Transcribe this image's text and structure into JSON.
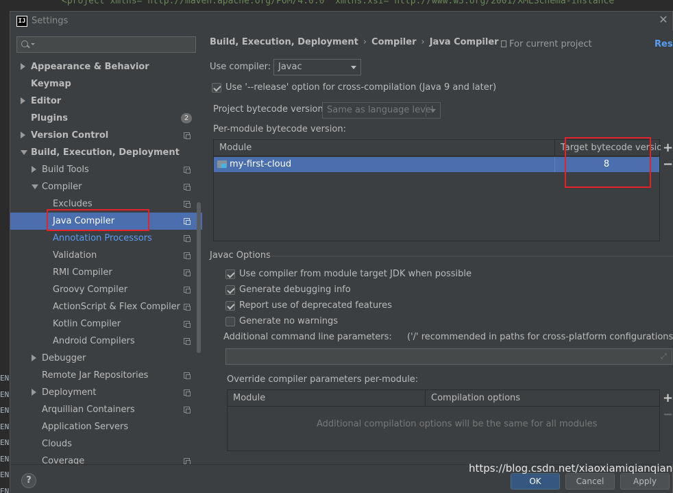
{
  "window": {
    "title": "Settings",
    "close_icon": "close-icon",
    "app_icon_text": "IJ"
  },
  "background_editor": {
    "line_text": "<project xmlns=\"http://maven.apache.org/POM/4.0.0\" xmlns:xsi=\"http://www.w3.org/2001/XMLSchema-instance\"",
    "gutter_lines": [
      "ENI",
      "ENI",
      "ENI",
      "ENI",
      "ENI",
      "ENI",
      "ENI",
      "ENI"
    ]
  },
  "sidebar": {
    "search_placeholder": "",
    "items": [
      {
        "label": "Appearance & Behavior",
        "bold": true,
        "arrow": "right",
        "copy": false
      },
      {
        "label": "Keymap",
        "bold": true,
        "arrow": "none",
        "copy": false
      },
      {
        "label": "Editor",
        "bold": true,
        "arrow": "right",
        "copy": false
      },
      {
        "label": "Plugins",
        "bold": true,
        "arrow": "none",
        "copy": false,
        "badge": "2"
      },
      {
        "label": "Version Control",
        "bold": true,
        "arrow": "right",
        "copy": true
      },
      {
        "label": "Build, Execution, Deployment",
        "bold": true,
        "arrow": "down",
        "copy": false
      },
      {
        "label": "Build Tools",
        "bold": false,
        "arrow": "right",
        "copy": true
      },
      {
        "label": "Compiler",
        "bold": false,
        "arrow": "down",
        "copy": true
      },
      {
        "label": "Excludes",
        "bold": false,
        "arrow": "none",
        "copy": true
      },
      {
        "label": "Java Compiler",
        "bold": false,
        "arrow": "none",
        "copy": true,
        "selected": true
      },
      {
        "label": "Annotation Processors",
        "bold": false,
        "arrow": "none",
        "copy": true,
        "link": true
      },
      {
        "label": "Validation",
        "bold": false,
        "arrow": "none",
        "copy": true
      },
      {
        "label": "RMI Compiler",
        "bold": false,
        "arrow": "none",
        "copy": true
      },
      {
        "label": "Groovy Compiler",
        "bold": false,
        "arrow": "none",
        "copy": true
      },
      {
        "label": "ActionScript & Flex Compiler",
        "bold": false,
        "arrow": "none",
        "copy": true
      },
      {
        "label": "Kotlin Compiler",
        "bold": false,
        "arrow": "none",
        "copy": true
      },
      {
        "label": "Android Compilers",
        "bold": false,
        "arrow": "none",
        "copy": true
      },
      {
        "label": "Debugger",
        "bold": false,
        "arrow": "right",
        "copy": false
      },
      {
        "label": "Remote Jar Repositories",
        "bold": false,
        "arrow": "none",
        "copy": true
      },
      {
        "label": "Deployment",
        "bold": false,
        "arrow": "right",
        "copy": true
      },
      {
        "label": "Arquillian Containers",
        "bold": false,
        "arrow": "none",
        "copy": true
      },
      {
        "label": "Application Servers",
        "bold": false,
        "arrow": "none",
        "copy": false
      },
      {
        "label": "Clouds",
        "bold": false,
        "arrow": "none",
        "copy": false
      },
      {
        "label": "Coverage",
        "bold": false,
        "arrow": "none",
        "copy": true
      }
    ]
  },
  "header": {
    "breadcrumbs": [
      "Build, Execution, Deployment",
      "Compiler",
      "Java Compiler"
    ],
    "separator": "›",
    "scope": "For current project",
    "reset": "Rese"
  },
  "compiler": {
    "use_compiler_label": "Use compiler:",
    "use_compiler_value": "Javac",
    "release_option": {
      "label": "Use '--release' option for cross-compilation (Java 9 and later)",
      "checked": true
    },
    "project_bytecode_label": "Project bytecode version:",
    "project_bytecode_value": "Same as language level",
    "per_module_label": "Per-module bytecode version:",
    "module_table": {
      "headers": [
        "Module",
        "Target bytecode version"
      ],
      "rows": [
        {
          "module": "my-first-cloud",
          "target": "8"
        }
      ]
    },
    "add_icon": "+",
    "remove_icon": "−"
  },
  "javac": {
    "section_title": "Javac Options",
    "options": [
      {
        "label": "Use compiler from module target JDK when possible",
        "checked": true
      },
      {
        "label": "Generate debugging info",
        "checked": true
      },
      {
        "label": "Report use of deprecated features",
        "checked": true
      },
      {
        "label": "Generate no warnings",
        "checked": false
      }
    ],
    "additional_label": "Additional command line parameters:",
    "additional_hint": "('/' recommended in paths for cross-platform configurations)",
    "additional_value": "",
    "override_label": "Override compiler parameters per-module:",
    "override_table": {
      "headers": [
        "Module",
        "Compilation options"
      ],
      "empty_text": "Additional compilation options will be the same for all modules"
    }
  },
  "footer": {
    "help": "?",
    "buttons": [
      "OK",
      "Cancel",
      "Apply"
    ],
    "watermark": "https://blog.csdn.net/xiaoxiamiqianqian"
  }
}
